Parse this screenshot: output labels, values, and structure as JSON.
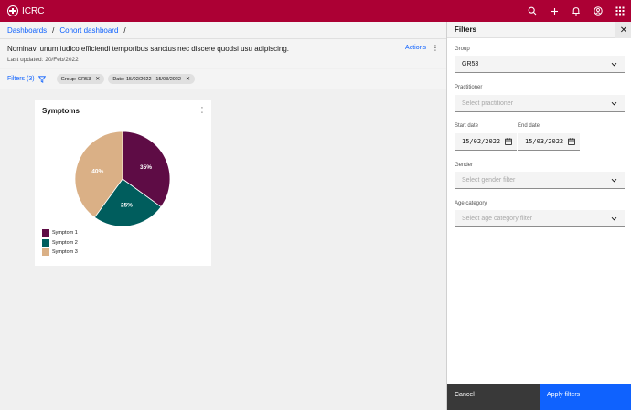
{
  "app": {
    "name": "ICRC"
  },
  "breadcrumb": {
    "items": [
      "Dashboards",
      "Cohort dashboard"
    ],
    "separator": "/"
  },
  "page": {
    "title": "Nominavi unum iudico efficiendi temporibus sanctus nec discere quodsi usu adipiscing.",
    "last_updated": "Last updated: 20/Feb/2022",
    "actions_label": "Actions"
  },
  "filters": {
    "link_label": "Filters (3)",
    "chips": [
      {
        "label": "Group: GR53"
      },
      {
        "label": "Date: 15/02/2022 - 15/03/2022"
      }
    ]
  },
  "card": {
    "title": "Symptoms"
  },
  "chart_data": {
    "type": "pie",
    "categories": [
      "Symptom 1",
      "Symptom 2",
      "Symptom 3"
    ],
    "values": [
      35,
      25,
      40
    ],
    "labels": [
      "35%",
      "25%",
      "40%"
    ],
    "colors": [
      "#5e0c45",
      "#005d5d",
      "#dab086"
    ],
    "title": "Symptoms",
    "legend": "bottom-left"
  },
  "panel": {
    "title": "Filters",
    "group": {
      "label": "Group",
      "value": "GR53"
    },
    "practitioner": {
      "label": "Practitioner",
      "placeholder": "Select practitioner"
    },
    "start_date": {
      "label": "Start date",
      "value": "15/02/2022"
    },
    "end_date": {
      "label": "End date",
      "value": "15/03/2022"
    },
    "gender": {
      "label": "Gender",
      "placeholder": "Select gender filter"
    },
    "age": {
      "label": "Age category",
      "placeholder": "Select age category filter"
    },
    "cancel_label": "Cancel",
    "apply_label": "Apply filters"
  },
  "colors": {
    "header": "#ac0034",
    "link": "#0f62fe",
    "cancel_button": "#393939",
    "apply_button": "#0f62fe"
  },
  "icons": [
    "search-icon",
    "add-icon",
    "notification-icon",
    "user-icon",
    "app-switcher-icon",
    "filter-icon",
    "close-icon",
    "overflow-menu-icon",
    "chevron-down-icon",
    "calendar-icon"
  ]
}
